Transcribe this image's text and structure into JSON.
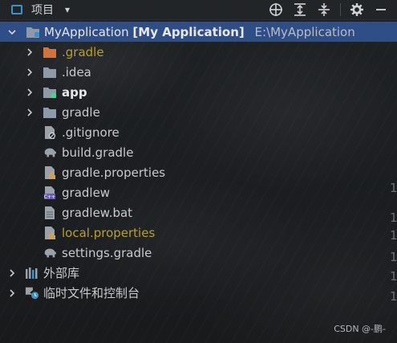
{
  "toolbar": {
    "title": "项目",
    "caret": "▾",
    "buttons": [
      "locate-icon",
      "expand-all-icon",
      "collapse-all-icon",
      "settings-icon",
      "hide-icon"
    ]
  },
  "tree": {
    "root": {
      "name": "MyApplication",
      "module": "[My Application]",
      "path": "E:\\MyApplication"
    },
    "items": [
      {
        "label": ".gradle",
        "color": "#b5a128"
      },
      {
        "label": ".idea"
      },
      {
        "label": "app"
      },
      {
        "label": "gradle"
      },
      {
        "label": ".gitignore"
      },
      {
        "label": "build.gradle"
      },
      {
        "label": "gradle.properties"
      },
      {
        "label": "gradlew"
      },
      {
        "label": "gradlew.bat"
      },
      {
        "label": "local.properties",
        "color": "#b5a128"
      },
      {
        "label": "settings.gradle"
      }
    ],
    "external_libs": "外部库",
    "scratches": "临时文件和控制台"
  },
  "gutter_numbers": [
    "1",
    "1",
    "1",
    "1",
    "1",
    "1"
  ],
  "watermark": "CSDN @-鹏-",
  "colors": {
    "selection": "#2f4d86",
    "accent_blue": "#3c93c8",
    "orange_folder": "#d4723b",
    "olive_text": "#b5a128"
  }
}
